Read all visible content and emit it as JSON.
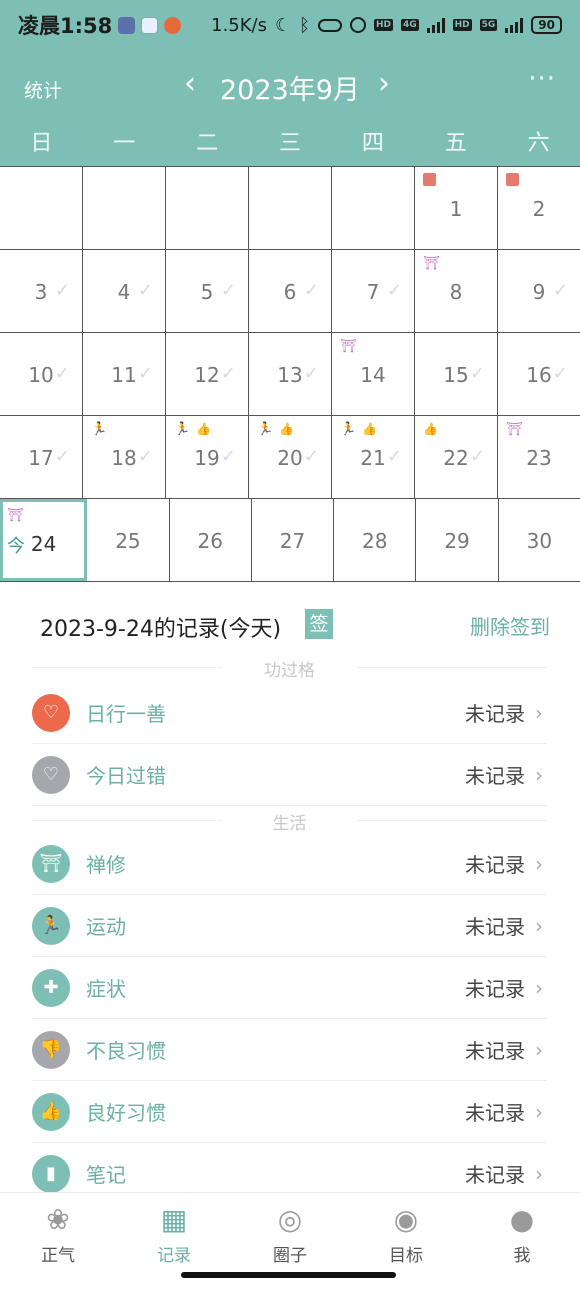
{
  "status_bar": {
    "time": "凌晨1:58",
    "net_speed": "1.5K/s",
    "moon": "☾",
    "bluetooth": "ᛒ",
    "hd1": "HD",
    "hd2": "HD",
    "g4": "4G",
    "g5": "5G",
    "battery": "90"
  },
  "header": {
    "stats": "统计",
    "prev": "‹",
    "month": "2023年9月",
    "next": "›",
    "more": "···"
  },
  "weekdays": [
    "日",
    "一",
    "二",
    "三",
    "四",
    "五",
    "六"
  ],
  "calendar": {
    "check": "✓",
    "today_tag": "今",
    "days": [
      "1",
      "2",
      "3",
      "4",
      "5",
      "6",
      "7",
      "8",
      "9",
      "10",
      "11",
      "12",
      "13",
      "14",
      "15",
      "16",
      "17",
      "18",
      "19",
      "20",
      "21",
      "22",
      "23",
      "24",
      "25",
      "26",
      "27",
      "28",
      "29",
      "30"
    ]
  },
  "records": {
    "title": "2023-9-24的记录(今天)",
    "sign": "签",
    "delete": "删除签到",
    "section1": "功过格",
    "section2": "生活",
    "items": [
      {
        "label": "日行一善",
        "value": "未记录",
        "icon": "heart-icon",
        "color": "#ec6a4b"
      },
      {
        "label": "今日过错",
        "value": "未记录",
        "icon": "broken-heart-icon",
        "color": "#a6a6ad"
      },
      {
        "label": "禅修",
        "value": "未记录",
        "icon": "meditation-icon",
        "color": "#7dbfb5"
      },
      {
        "label": "运动",
        "value": "未记录",
        "icon": "run-icon",
        "color": "#7dbfb5"
      },
      {
        "label": "症状",
        "value": "未记录",
        "icon": "first-aid-icon",
        "color": "#7dbfb5"
      },
      {
        "label": "不良习惯",
        "value": "未记录",
        "icon": "thumbs-down-icon",
        "color": "#a6a6ad"
      },
      {
        "label": "良好习惯",
        "value": "未记录",
        "icon": "thumbs-up-icon",
        "color": "#7dbfb5"
      },
      {
        "label": "笔记",
        "value": "未记录",
        "icon": "notebook-icon",
        "color": "#7dbfb5"
      }
    ],
    "chevron": "›"
  },
  "nav": [
    {
      "label": "正气",
      "icon": "lotus-icon"
    },
    {
      "label": "记录",
      "icon": "calendar-icon"
    },
    {
      "label": "圈子",
      "icon": "circle-icon"
    },
    {
      "label": "目标",
      "icon": "target-icon"
    },
    {
      "label": "我",
      "icon": "user-icon"
    }
  ],
  "colors": {
    "primary": "#7dbfb5",
    "accent_text": "#6ab0a5"
  }
}
